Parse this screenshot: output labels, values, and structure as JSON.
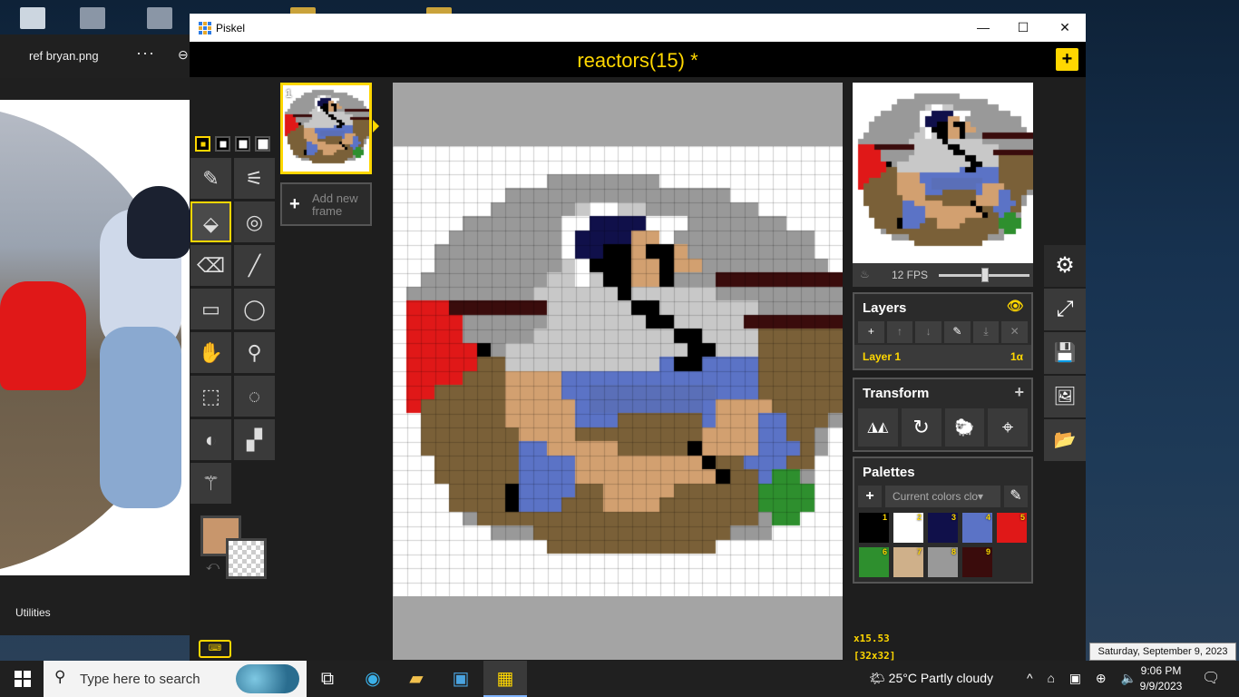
{
  "photo_viewer": {
    "file_name": "ref bryan.png",
    "more": "···",
    "zoom_glyph": "⊖",
    "footer_text": "Utilities"
  },
  "window": {
    "app_name": "Piskel",
    "min": "—",
    "max": "☐",
    "close": "✕"
  },
  "header": {
    "doc_title": "reactors(15) *",
    "new_glyph": "+"
  },
  "tools": {
    "items": [
      {
        "name": "pen-tool",
        "glyph": "✎"
      },
      {
        "name": "mirror-pen-tool",
        "glyph": "⚟"
      },
      {
        "name": "paint-bucket-tool",
        "glyph": "⬙"
      },
      {
        "name": "paint-same-color-tool",
        "glyph": "◎"
      },
      {
        "name": "eraser-tool",
        "glyph": "⌫"
      },
      {
        "name": "stroke-tool",
        "glyph": "╱"
      },
      {
        "name": "rectangle-tool",
        "glyph": "▭"
      },
      {
        "name": "circle-tool",
        "glyph": "◯"
      },
      {
        "name": "move-tool",
        "glyph": "✋"
      },
      {
        "name": "shape-selection-tool",
        "glyph": "⚲"
      },
      {
        "name": "rectangle-selection-tool",
        "glyph": "⬚"
      },
      {
        "name": "lasso-selection-tool",
        "glyph": "◌"
      },
      {
        "name": "lighten-tool",
        "glyph": "◐"
      },
      {
        "name": "dithering-tool",
        "glyph": "▞"
      },
      {
        "name": "color-picker-tool",
        "glyph": "⚚"
      }
    ],
    "selected_index": 2,
    "primary_color": "#c8966c",
    "swap_glyph": "⤺",
    "keyboard_glyph": "⌨"
  },
  "frames": {
    "first_number": "1",
    "add_label_line1": "Add new",
    "add_label_line2": "frame",
    "add_glyph": "+"
  },
  "animation": {
    "fps_label": "12 FPS",
    "onion_glyph": "♨"
  },
  "layers": {
    "title": "Layers",
    "eye_glyph": "👁",
    "buttons": [
      "+",
      "↑",
      "↓",
      "✎",
      "⤓",
      "✕"
    ],
    "layer_name": "Layer 1",
    "layer_opacity": "1α"
  },
  "transform": {
    "title": "Transform",
    "add_glyph": "+",
    "buttons": [
      "◮◭",
      "↻",
      "🐑",
      "⌖"
    ]
  },
  "palettes": {
    "title": "Palettes",
    "add_glyph": "+",
    "selected": "Current colors clo▾",
    "edit_glyph": "✎",
    "colors": [
      {
        "num": "1",
        "hex": "#000000"
      },
      {
        "num": "2",
        "hex": "#ffffff"
      },
      {
        "num": "3",
        "hex": "#10104a"
      },
      {
        "num": "4",
        "hex": "#5b73c6"
      },
      {
        "num": "5",
        "hex": "#e01818"
      },
      {
        "num": "6",
        "hex": "#2e8f2e"
      },
      {
        "num": "7",
        "hex": "#cfb08a"
      },
      {
        "num": "8",
        "hex": "#999999"
      },
      {
        "num": "9",
        "hex": "#3a0c0c"
      }
    ]
  },
  "status": {
    "zoom": "x15.53",
    "size": "[32x32]"
  },
  "side_buttons": [
    {
      "name": "settings-icon",
      "glyph": "⚙"
    },
    {
      "name": "resize-icon",
      "glyph": "⤢"
    },
    {
      "name": "save-icon",
      "glyph": "💾"
    },
    {
      "name": "export-image-icon",
      "glyph": "🖼"
    },
    {
      "name": "open-folder-icon",
      "glyph": "📂"
    }
  ],
  "tooltip": "Saturday, September 9, 2023",
  "taskbar": {
    "search_placeholder": "Type here to search",
    "weather": "🌤 25°C  Partly cloudy",
    "tray": "^ ⌂ ▣ ⊕ 🔈",
    "time": "9:06 PM",
    "date": "9/9/2023",
    "notif": "🗨"
  },
  "sprite": {
    "palette_key": {
      ".": "#ffffff",
      "g": "#999999",
      "l": "#c8c8c8",
      "k": "#000000",
      "n": "#10104a",
      "s": "#d2a070",
      "b": "#5b73c6",
      "d": "#5a6fb8",
      "r": "#e01818",
      "m": "#3a0c0c",
      "w": "#7a6038",
      "G": "#2e8f2e"
    },
    "rows": [
      "................................",
      "................................",
      "...........gggggggg.............",
      "........gggggggggggggggg........",
      ".......ggggggl..llgggggggg......",
      ".....ggggggg..nnnn...ggggggg....",
      "....gggggggg.nnnnss.gggggggggg..",
      "...ggggggggg.nnkkskksggggggggg..",
      "...gggggggggl.kkksskssggggggggg.",
      "..gggggggggll.lkksskgggmmmmmmmmm",
      ".gggggggggllllllkllllllggggggggg",
      ".rrrmmmmmmmllllllkklllllllgggggg",
      ".rrrrgggggglllllllkklllllmmmmmmm",
      ".rrrrgggggllllllllllkkllllwwwwww",
      ".rrrrrkglllllllllllllkklllwwwwww",
      ".rrrrrwwlllllllllllbkkbbbbwwwwww",
      ".rrrrwwwssssbbbbbbbbbbbbbbwwwwww",
      ".rrwwwwwssssbbdddddddddbbbwwwwww",
      ".rwwwwwwsssssbddddddddbsssswwwww",
      "..wwwwwwsssssbbbwwwwwwbsssbbwwwg",
      "..wwwwwwwsssswwwwwwwwwssssbbwwg.",
      "..wwwwwwwbbssssswwwwwkssssbbbwg.",
      "...wwwwwwbbbbssssssssskwwbbbww..",
      "...wwwwwwbbbbsssssssssskwwbGGg..",
      "....wwwwkbbbbwwssssswwwwwwGGGG..",
      "....wwwwkbbbwwwsssswwwwwwwGGGG..",
      ".....gwwwwwwwwwwwwwwwwwwwwgGG...",
      ".......gggwwwwwwwwwwwwwwggg.....",
      "...........wwwwwwwwwwww.........",
      "................................",
      "................................",
      "................................"
    ]
  }
}
